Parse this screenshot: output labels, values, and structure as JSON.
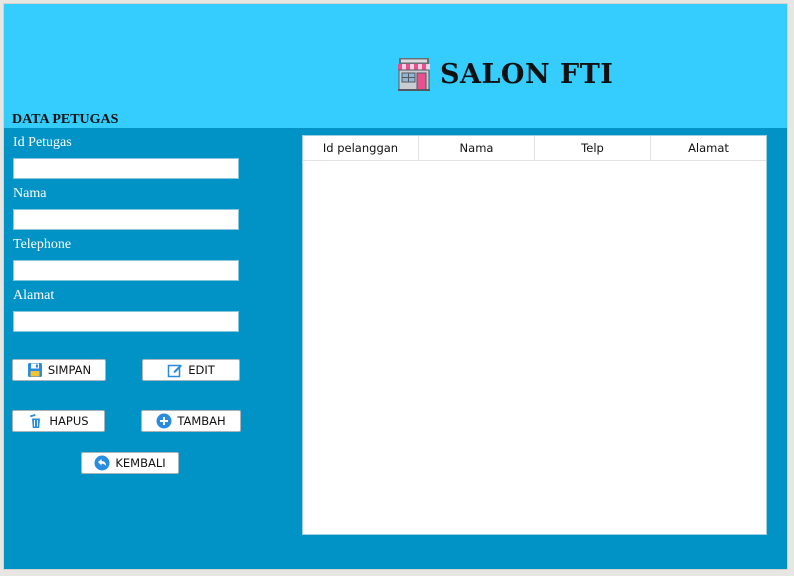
{
  "header": {
    "title": "SALON FTI",
    "icon": "shop-icon"
  },
  "form": {
    "section_title": "DATA PETUGAS",
    "fields": [
      {
        "label": "Id Petugas",
        "value": "",
        "placeholder": ""
      },
      {
        "label": "Nama",
        "value": "",
        "placeholder": ""
      },
      {
        "label": "Telephone",
        "value": "",
        "placeholder": ""
      },
      {
        "label": "Alamat",
        "value": "",
        "placeholder": ""
      }
    ]
  },
  "buttons": {
    "simpan": {
      "label": "SIMPAN",
      "icon": "floppy-disk-icon"
    },
    "edit": {
      "label": "EDIT",
      "icon": "edit-icon"
    },
    "hapus": {
      "label": "HAPUS",
      "icon": "trash-icon"
    },
    "tambah": {
      "label": "TAMBAH",
      "icon": "plus-circle-icon"
    },
    "kembali": {
      "label": "KEMBALI",
      "icon": "back-arrow-icon"
    }
  },
  "table": {
    "columns": [
      "Id pelanggan",
      "Nama",
      "Telp",
      "Alamat"
    ],
    "rows": []
  },
  "colors": {
    "header_bg": "#34cdfd",
    "panel_bg": "#0293c6",
    "accent_blue": "#2a8ce0"
  }
}
